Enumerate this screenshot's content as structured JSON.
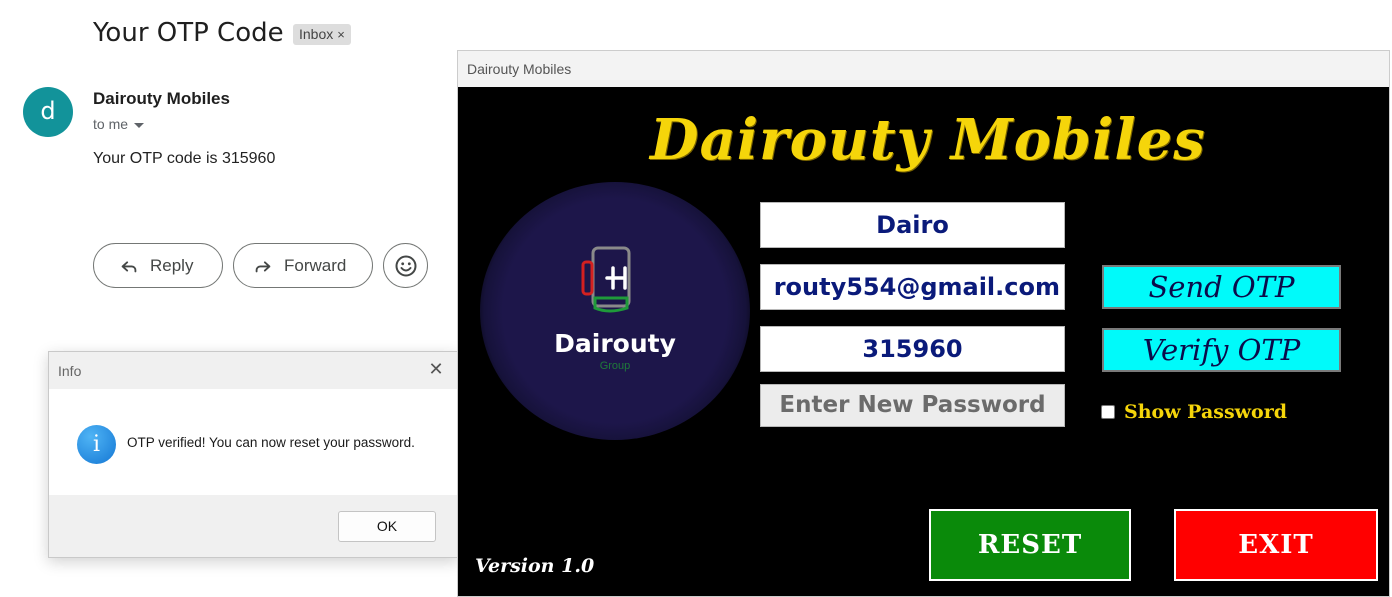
{
  "email": {
    "subject": "Your OTP Code",
    "badge": "Inbox",
    "badge_close": "×",
    "avatar_letter": "d",
    "sender": "Dairouty Mobiles",
    "to": "to me",
    "body": "Your OTP code is 315960",
    "reply_label": "Reply",
    "forward_label": "Forward"
  },
  "dialog": {
    "title": "Info",
    "close": "✕",
    "icon_letter": "i",
    "message": "OTP verified! You can now reset your password.",
    "ok_label": "OK"
  },
  "app": {
    "window_title": "Dairouty Mobiles",
    "brand": "Dairouty Mobiles",
    "logo_word": "Dairouty",
    "logo_sub": "Group",
    "username_value": "Dairo",
    "email_value": "routy554@gmail.com",
    "otp_value": "315960",
    "new_password_placeholder": "Enter New Password",
    "send_otp_label": "Send OTP",
    "verify_otp_label": "Verify OTP",
    "show_password_label": "Show Password",
    "reset_label": "RESET",
    "exit_label": "EXIT",
    "version": "Version 1.0"
  },
  "colors": {
    "brand_yellow": "#f5d50a",
    "otp_button_cyan": "#00fafa",
    "reset_green": "#0a8a0a",
    "exit_red": "#ff0000",
    "avatar_teal": "#12939a"
  }
}
